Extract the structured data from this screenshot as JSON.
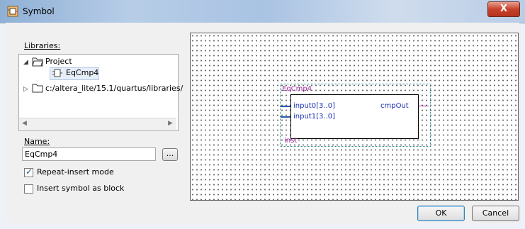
{
  "window": {
    "title": "Symbol",
    "close_label": "X"
  },
  "libraries": {
    "label": "Libraries:",
    "tree": [
      {
        "label": "Project",
        "expanded": true
      },
      {
        "label": "EqCmp4",
        "selected": true
      },
      {
        "label": "c:/altera_lite/15.1/quartus/libraries/",
        "expanded": false
      }
    ]
  },
  "name": {
    "label": "Name:",
    "value": "EqCmp4",
    "browse_label": "..."
  },
  "options": {
    "repeat_insert": {
      "label": "Repeat-insert mode",
      "checked": true
    },
    "insert_as_block": {
      "label": "Insert symbol as block",
      "checked": false
    }
  },
  "preview": {
    "symbol_name": "EqCmp4",
    "instance": "inst",
    "inputs": [
      "input0[3..0]",
      "input1[3..0]"
    ],
    "output": "cmpOut"
  },
  "buttons": {
    "ok": "OK",
    "cancel": "Cancel"
  },
  "colors": {
    "pin_input": "#2a5ab3",
    "pin_output": "#a12ca1",
    "symbol_text": "#a12ca1",
    "port_text": "#1a2fb0"
  }
}
